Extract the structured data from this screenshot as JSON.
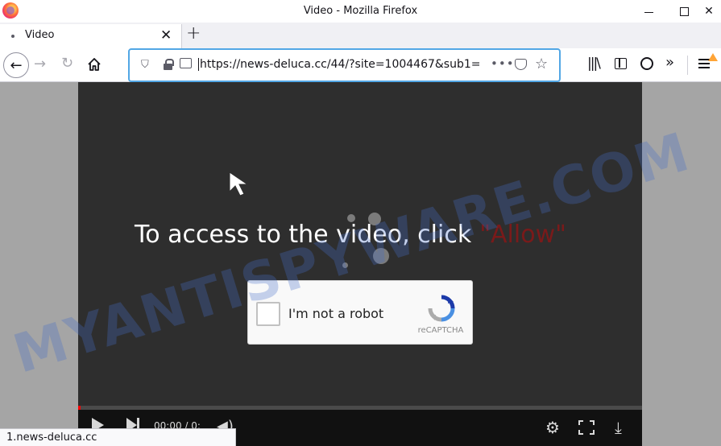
{
  "window": {
    "title": "Video - Mozilla Firefox"
  },
  "tab": {
    "label": "Video"
  },
  "urlbar": {
    "url": "https://news-deluca.cc/44/?site=1004467&sub1=‍‍‍‍",
    "overflow_dots": "•••"
  },
  "page": {
    "headline": "To access to the video, click",
    "headline_highlight": "\"Allow\"",
    "captcha_label": "I'm not a robot",
    "captcha_brand": "reCAPTCHA",
    "player_time": "00:00 / 0:"
  },
  "watermark": "MYANTISPYWARE.COM",
  "status": {
    "link": "1.news-deluca.cc"
  },
  "colors": {
    "accent_focus": "#52a7e5",
    "player_bg": "#2e2e2e",
    "progress": "#ff0000",
    "warning": "#ffa436"
  }
}
